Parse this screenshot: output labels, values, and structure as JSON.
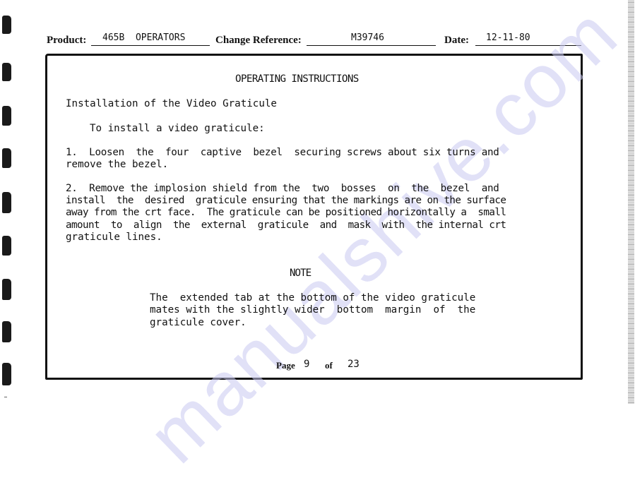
{
  "header": {
    "product_label": "Product:",
    "product_value": "465B  OPERATORS",
    "change_ref_label": "Change Reference:",
    "change_ref_value": "M39746",
    "date_label": "Date:",
    "date_value": "12-11-80"
  },
  "document": {
    "title": "OPERATING INSTRUCTIONS",
    "section_heading": "Installation of the Video Graticule",
    "intro": "To install a video graticule:",
    "steps": [
      {
        "lines": [
          "1.  Loosen  the  four  captive  bezel  securing screws about six turns and",
          "remove the bezel."
        ]
      },
      {
        "lines": [
          "2.  Remove the implosion shield from the  two  bosses  on  the  bezel  and",
          "install  the  desired  graticule ensuring that the markings are on the surface",
          "away from the crt face.  The graticule can be positioned horizontally a  small",
          "amount  to  align  the  external  graticule  and  mask  with  the internal crt",
          "graticule lines."
        ]
      }
    ],
    "note_heading": "NOTE",
    "note_lines": [
      "The  extended tab at the bottom of the video graticule",
      "mates with the slightly wider  bottom  margin  of  the",
      "graticule cover."
    ]
  },
  "footer": {
    "page_label": "Page",
    "page_number": "9",
    "of_label": "of",
    "total_pages": "23"
  },
  "watermark": "manualshive.com",
  "colors": {
    "ink": "#111111",
    "watermark": "#c9c9f2"
  }
}
